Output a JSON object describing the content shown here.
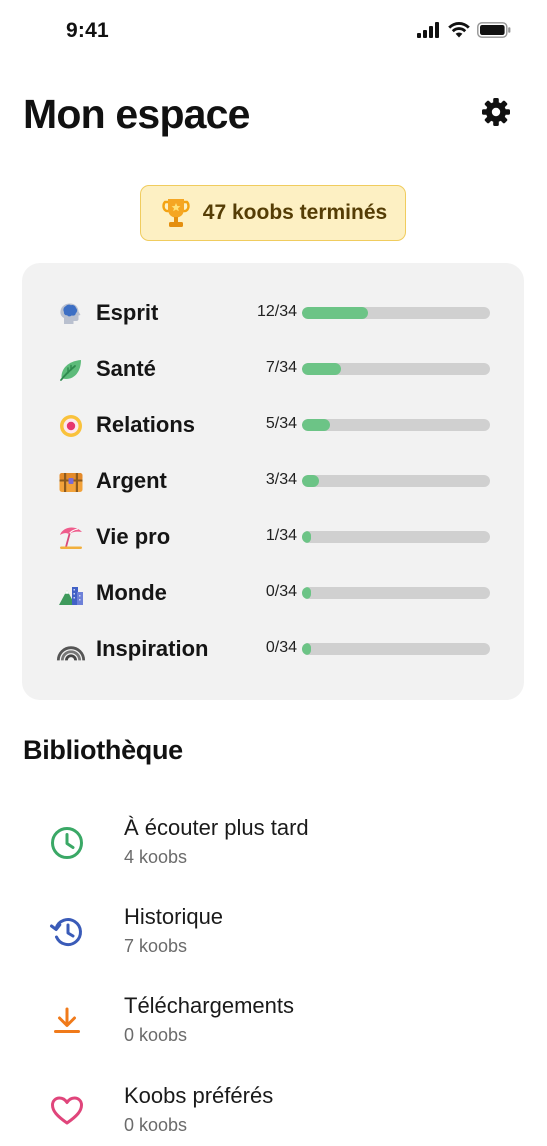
{
  "status_bar": {
    "time": "9:41"
  },
  "header": {
    "title": "Mon espace"
  },
  "achievement": {
    "text": "47 koobs terminés"
  },
  "categories": [
    {
      "label": "Esprit",
      "count": "12/34",
      "progress": 0.353
    },
    {
      "label": "Santé",
      "count": "7/34",
      "progress": 0.206
    },
    {
      "label": "Relations",
      "count": "5/34",
      "progress": 0.147
    },
    {
      "label": "Argent",
      "count": "3/34",
      "progress": 0.088
    },
    {
      "label": "Vie pro",
      "count": "1/34",
      "progress": 0.029
    },
    {
      "label": "Monde",
      "count": "0/34",
      "progress": 0.0
    },
    {
      "label": "Inspiration",
      "count": "0/34",
      "progress": 0.0
    }
  ],
  "library": {
    "title": "Bibliothèque",
    "items": [
      {
        "title": "À écouter plus tard",
        "subtitle": "4 koobs",
        "icon": "clock-icon"
      },
      {
        "title": "Historique",
        "subtitle": "7 koobs",
        "icon": "history-icon"
      },
      {
        "title": "Téléchargements",
        "subtitle": "0 koobs",
        "icon": "download-icon"
      },
      {
        "title": "Koobs préférés",
        "subtitle": "0 koobs",
        "icon": "heart-icon"
      }
    ]
  },
  "colors": {
    "progress_fill": "#6cc486",
    "progress_track": "#d0d0d0",
    "badge_bg": "#fdf0c3",
    "badge_border": "#f0cc5e",
    "clock": "#3aa866",
    "history": "#3a5bb8",
    "download": "#f07a1a",
    "heart": "#e0457b"
  }
}
